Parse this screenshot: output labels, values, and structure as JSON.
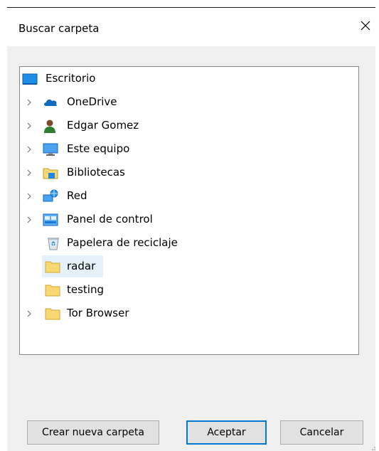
{
  "dialog": {
    "title": "Buscar carpeta"
  },
  "tree": {
    "items": [
      {
        "label": "Escritorio",
        "icon": "desktop-icon",
        "expandable": false,
        "selected": false
      },
      {
        "label": "OneDrive",
        "icon": "onedrive-cloud-icon",
        "expandable": true,
        "selected": false
      },
      {
        "label": "Edgar Gomez",
        "icon": "user-icon",
        "expandable": true,
        "selected": false
      },
      {
        "label": "Este equipo",
        "icon": "computer-icon",
        "expandable": true,
        "selected": false
      },
      {
        "label": "Bibliotecas",
        "icon": "libraries-icon",
        "expandable": true,
        "selected": false
      },
      {
        "label": "Red",
        "icon": "network-icon",
        "expandable": true,
        "selected": false
      },
      {
        "label": "Panel de control",
        "icon": "control-panel-icon",
        "expandable": true,
        "selected": false
      },
      {
        "label": "Papelera de reciclaje",
        "icon": "recycle-bin-icon",
        "expandable": false,
        "selected": false
      },
      {
        "label": "radar",
        "icon": "folder-icon",
        "expandable": false,
        "selected": true
      },
      {
        "label": "testing",
        "icon": "folder-icon",
        "expandable": false,
        "selected": false
      },
      {
        "label": "Tor Browser",
        "icon": "folder-icon",
        "expandable": true,
        "selected": false
      }
    ]
  },
  "buttons": {
    "new_folder": "Crear nueva carpeta",
    "accept": "Aceptar",
    "cancel": "Cancelar"
  },
  "colors": {
    "selection": "#e5f1fb",
    "default_button_border": "#0078d7",
    "folder": "#f8d775"
  }
}
